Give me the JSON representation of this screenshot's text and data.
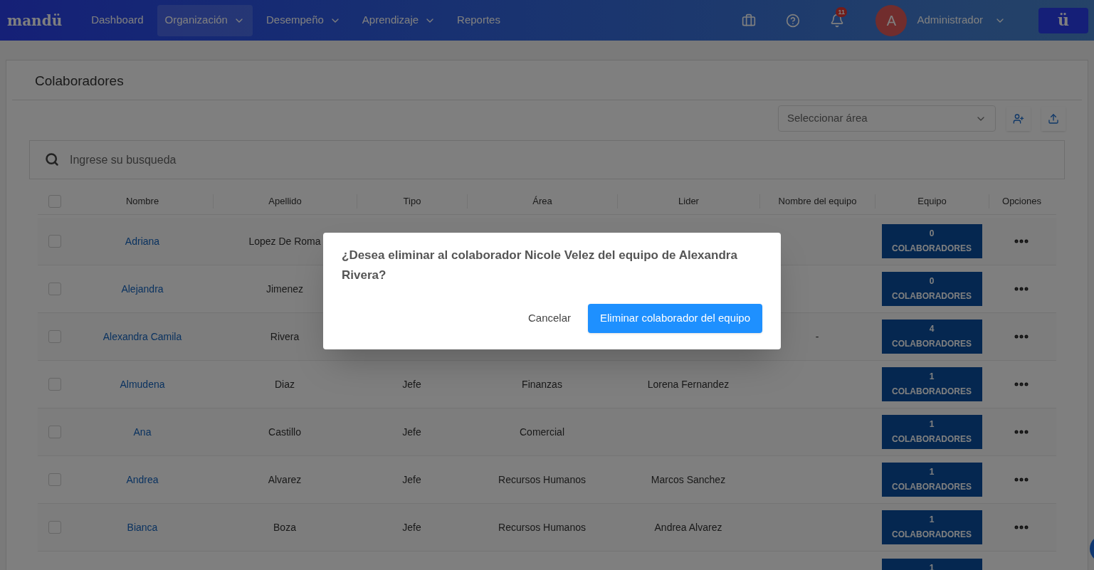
{
  "navbar": {
    "logo": "mandü",
    "items": [
      {
        "label": "Dashboard",
        "dropdown": false,
        "selected": false
      },
      {
        "label": "Organización",
        "dropdown": true,
        "selected": true
      },
      {
        "label": "Desempeño",
        "dropdown": true,
        "selected": false
      },
      {
        "label": "Aprendizaje",
        "dropdown": true,
        "selected": false
      },
      {
        "label": "Reportes",
        "dropdown": false,
        "selected": false
      }
    ],
    "notifications": "11",
    "avatar": "A",
    "user": "Administrador",
    "brand_button": "ü"
  },
  "page": {
    "title": "Colaboradores",
    "area_select": {
      "placeholder": "Seleccionar área"
    },
    "search": {
      "placeholder": "Ingrese su busqueda"
    }
  },
  "table": {
    "select_all": {
      "checked": false
    },
    "columns": [
      "Nombre",
      "Apellido",
      "Tipo",
      "Área",
      "Lider",
      "Nombre del equipo",
      "Equipo",
      "Opciones"
    ],
    "rows": [
      {
        "kind": "full",
        "checked": false,
        "nombre": "Adriana",
        "apellido": "Lopez De Roma",
        "tipo": "",
        "area": "",
        "lider": "",
        "equipo_nombre": "",
        "count": "0",
        "unit": "COLABORADORES"
      },
      {
        "kind": "full",
        "checked": false,
        "nombre": "Alejandra",
        "apellido": "Jimenez",
        "tipo": "",
        "area": "",
        "lider": "",
        "equipo_nombre": "",
        "count": "0",
        "unit": "COLABORADORES"
      },
      {
        "kind": "full",
        "checked": false,
        "nombre": "Alexandra Camila",
        "apellido": "Rivera",
        "tipo": "",
        "area": "",
        "lider": "",
        "equipo_nombre": "-",
        "count": "4",
        "unit": "COLABORADORES"
      },
      {
        "kind": "full",
        "checked": false,
        "nombre": "Almudena",
        "apellido": "Diaz",
        "tipo": "Jefe",
        "area": "Finanzas",
        "lider": "Lorena Fernandez",
        "equipo_nombre": "",
        "count": "1",
        "unit": "COLABORADORES"
      },
      {
        "kind": "full",
        "checked": false,
        "nombre": "Ana",
        "apellido": "Castillo",
        "tipo": "Jefe",
        "area": "Comercial",
        "lider": "",
        "equipo_nombre": "",
        "count": "1",
        "unit": "COLABORADORES"
      },
      {
        "kind": "full",
        "checked": false,
        "nombre": "Andrea",
        "apellido": "Alvarez",
        "tipo": "Jefe",
        "area": "Recursos Humanos",
        "lider": "Marcos Sanchez",
        "equipo_nombre": "",
        "count": "1",
        "unit": "COLABORADORES"
      },
      {
        "kind": "full",
        "checked": false,
        "nombre": "Bianca",
        "apellido": "Boza",
        "tipo": "Jefe",
        "area": "Recursos Humanos",
        "lider": "Andrea Alvarez",
        "equipo_nombre": "",
        "count": "1",
        "unit": "COLABORADORES"
      },
      {
        "kind": "partial",
        "count": "1"
      }
    ]
  },
  "dialog": {
    "message": "¿Desea eliminar al colaborador Nicole Velez del equipo de Alexandra Rivera?",
    "cancel": "Cancelar",
    "confirm": "Eliminar colaborador del equipo"
  }
}
